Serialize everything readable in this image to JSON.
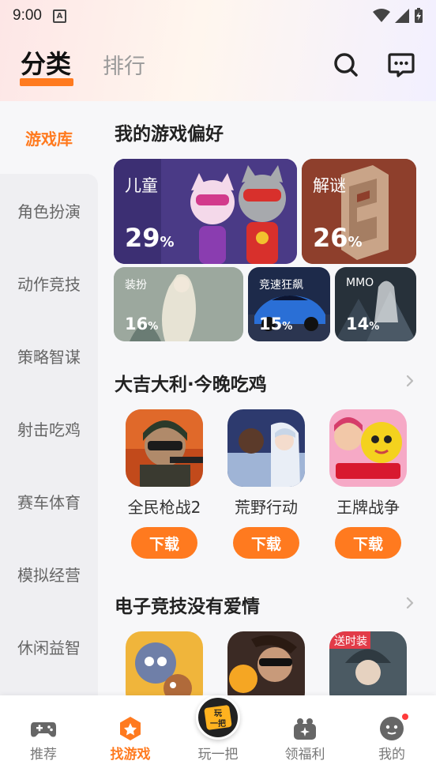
{
  "status_bar": {
    "time": "9:00",
    "notification_icon": "A"
  },
  "header": {
    "tabs": [
      {
        "label": "分类",
        "active": true
      },
      {
        "label": "排行",
        "active": false
      }
    ],
    "icons": [
      "search-icon",
      "message-icon"
    ]
  },
  "sidebar": {
    "items": [
      {
        "label": "游戏库",
        "active": true
      },
      {
        "label": "角色扮演"
      },
      {
        "label": "动作竞技"
      },
      {
        "label": "策略智谋"
      },
      {
        "label": "射击吃鸡"
      },
      {
        "label": "赛车体育"
      },
      {
        "label": "模拟经营"
      },
      {
        "label": "休闲益智"
      }
    ]
  },
  "preferences": {
    "title": "我的游戏偏好",
    "cards": [
      {
        "label": "儿童",
        "percent": "29",
        "unit": "%"
      },
      {
        "label": "解谜",
        "percent": "26",
        "unit": "%"
      },
      {
        "label": "装扮",
        "percent": "16",
        "unit": "%"
      },
      {
        "label": "竞速狂飙",
        "percent": "15",
        "unit": "%"
      },
      {
        "label": "MMO",
        "percent": "14",
        "unit": "%"
      }
    ]
  },
  "section1": {
    "title": "大吉大利·今晚吃鸡",
    "games": [
      {
        "name": "全民枪战2",
        "button": "下载"
      },
      {
        "name": "荒野行动",
        "button": "下载"
      },
      {
        "name": "王牌战争",
        "button": "下载"
      }
    ]
  },
  "section2": {
    "title": "电子竞技没有爱情",
    "visible_badge": "送时装"
  },
  "bottom_nav": {
    "items": [
      {
        "label": "推荐"
      },
      {
        "label": "找游戏",
        "active": true
      },
      {
        "label": "玩一把"
      },
      {
        "label": "领福利"
      },
      {
        "label": "我的"
      }
    ],
    "center_badge_text": "玩一把"
  },
  "colors": {
    "accent": "#ff7a1f",
    "badge": "#ff3b3b"
  }
}
